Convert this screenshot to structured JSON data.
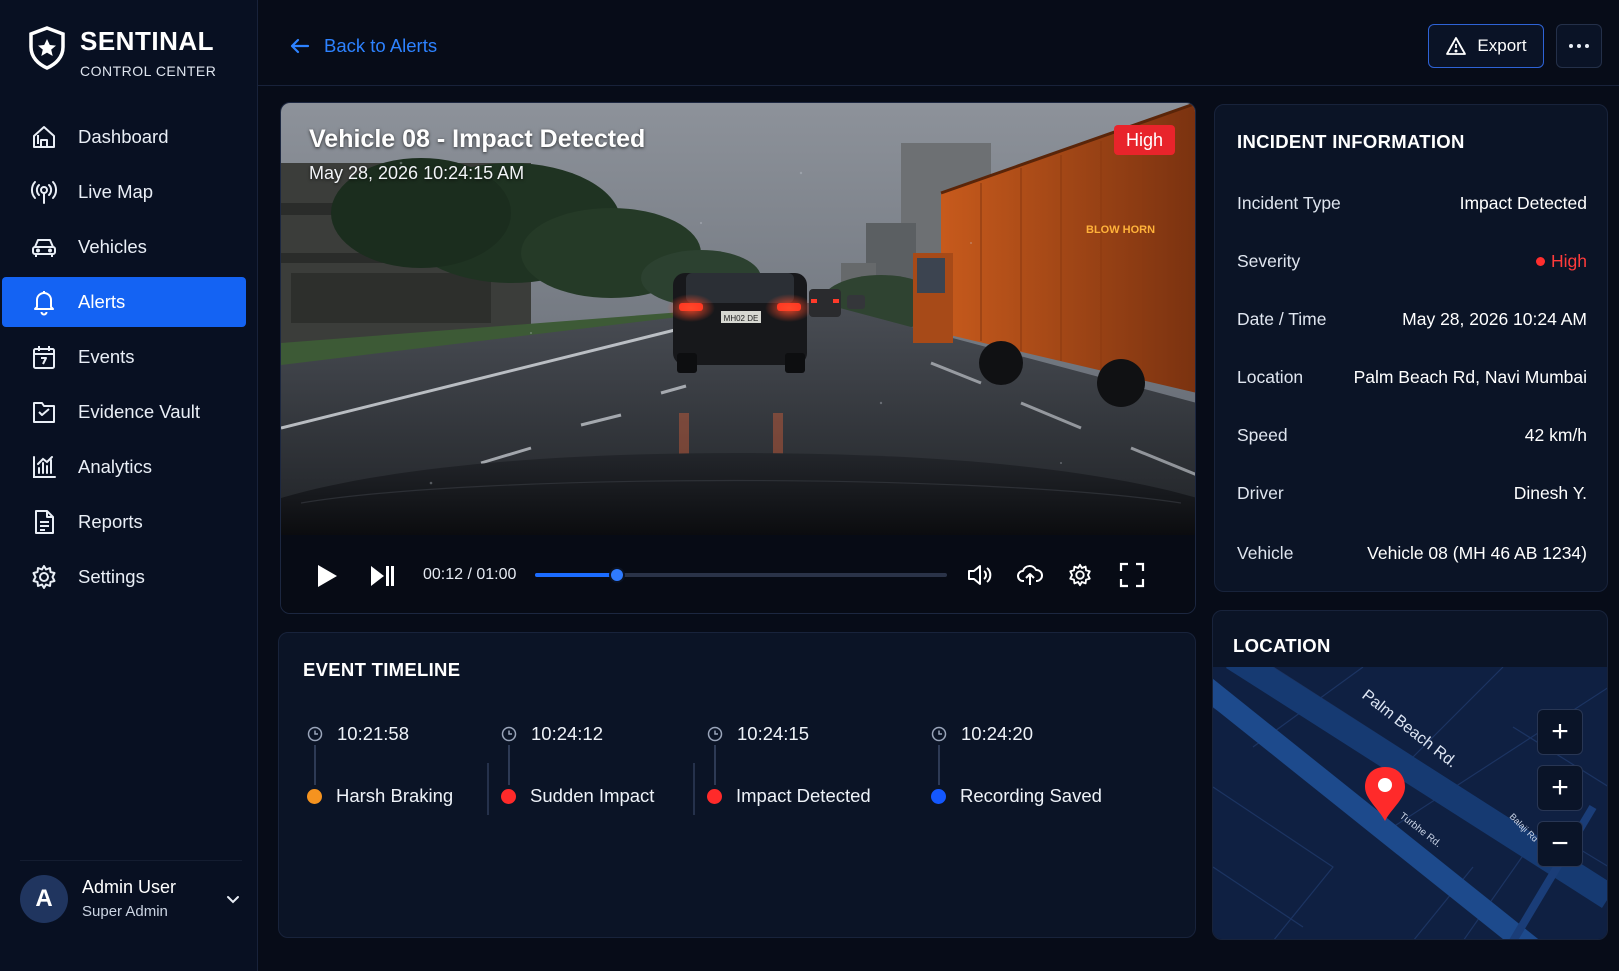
{
  "brand": {
    "name": "SENTINAL",
    "subtitle": "CONTROL CENTER"
  },
  "nav": [
    {
      "label": "Dashboard",
      "icon": "home-icon"
    },
    {
      "label": "Live Map",
      "icon": "broadcast-icon"
    },
    {
      "label": "Vehicles",
      "icon": "car-icon"
    },
    {
      "label": "Alerts",
      "icon": "bell-icon",
      "active": true
    },
    {
      "label": "Events",
      "icon": "calendar-icon"
    },
    {
      "label": "Evidence Vault",
      "icon": "folder-icon"
    },
    {
      "label": "Analytics",
      "icon": "bar-chart-icon"
    },
    {
      "label": "Reports",
      "icon": "document-icon"
    },
    {
      "label": "Settings",
      "icon": "gear-icon"
    }
  ],
  "user": {
    "initial": "A",
    "name": "Admin User",
    "role": "Super Admin"
  },
  "topbar": {
    "back_label": "Back to Alerts",
    "export_label": "Export"
  },
  "video": {
    "title": "Vehicle 08 - Impact Detected",
    "timestamp": "May 28, 2026 10:24:15 AM",
    "severity_badge": "High",
    "timecode": "00:12 / 01:00",
    "progress": 0.2,
    "scene_text": {
      "truck_sign": "BLOW HORN",
      "plate": "MH02 DE"
    }
  },
  "incident": {
    "title": "INCIDENT INFORMATION",
    "rows": [
      {
        "label": "Incident Type",
        "value": "Impact Detected"
      },
      {
        "label": "Severity",
        "value": "High"
      },
      {
        "label": "Date / Time",
        "value": "May 28, 2026 10:24 AM"
      },
      {
        "label": "Location",
        "value": "Palm Beach Rd, Navi Mumbai"
      },
      {
        "label": "Speed",
        "value": "42 km/h"
      },
      {
        "label": "Driver",
        "value": "Dinesh Y."
      },
      {
        "label": "Vehicle",
        "value": "Vehicle 08 (MH 46 AB 1234)"
      }
    ]
  },
  "timeline": {
    "title": "EVENT TIMELINE",
    "events": [
      {
        "time": "10:21:58",
        "label": "Harsh Braking",
        "color": "#f5931f"
      },
      {
        "time": "10:24:12",
        "label": "Sudden Impact",
        "color": "#ff2a2a"
      },
      {
        "time": "10:24:15",
        "label": "Impact Detected",
        "color": "#ff2a2a"
      },
      {
        "time": "10:24:20",
        "label": "Recording Saved",
        "color": "#1458ff"
      }
    ]
  },
  "location": {
    "title": "LOCATION",
    "roads": {
      "main": "Palm Beach Rd.",
      "side": "Turbhe Rd.",
      "other": "Balaji Rd"
    },
    "zoom_in_label": "+",
    "zoom_in_label_2": "+",
    "zoom_out_label": "−"
  },
  "colors": {
    "accent": "#1463f3",
    "severity_high": "#e8242b",
    "background": "#070c18"
  }
}
